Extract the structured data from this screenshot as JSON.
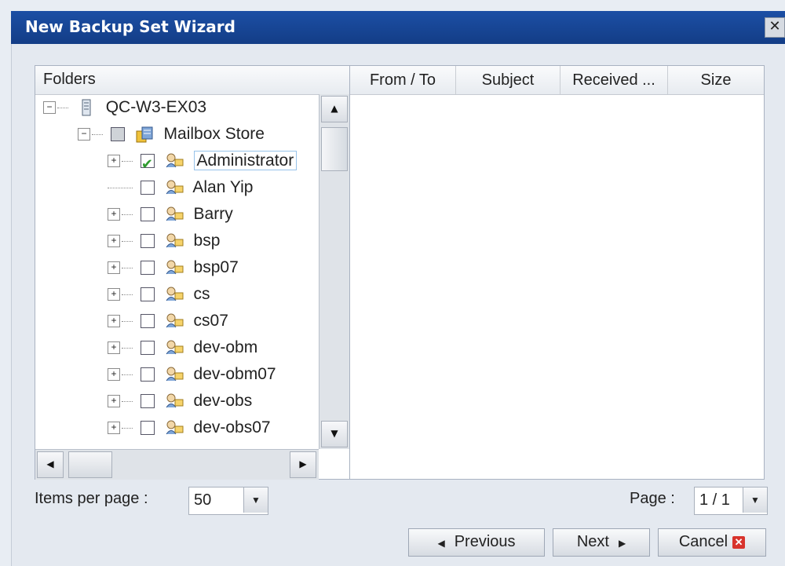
{
  "window": {
    "title": "New Backup Set Wizard",
    "close_glyph": "✕"
  },
  "folders": {
    "header": "Folders",
    "root": {
      "label": "QC-W3-EX03",
      "expander": "−"
    },
    "store": {
      "label": "Mailbox Store",
      "expander": "−"
    },
    "items": [
      {
        "label": "Administrator",
        "checked": true,
        "selected": true
      },
      {
        "label": "Alan Yip",
        "checked": false
      },
      {
        "label": "Barry",
        "checked": false
      },
      {
        "label": "bsp",
        "checked": false
      },
      {
        "label": "bsp07",
        "checked": false
      },
      {
        "label": "cs",
        "checked": false
      },
      {
        "label": "cs07",
        "checked": false
      },
      {
        "label": "dev-obm",
        "checked": false
      },
      {
        "label": "dev-obm07",
        "checked": false
      },
      {
        "label": "dev-obs",
        "checked": false
      },
      {
        "label": "dev-obs07",
        "checked": false
      }
    ]
  },
  "messages": {
    "columns": [
      "From / To",
      "Subject",
      "Received ...",
      "Size"
    ]
  },
  "pagination": {
    "items_label": "Items per page :",
    "items_value": "50",
    "page_label": "Page :",
    "page_value": "1 / 1"
  },
  "buttons": {
    "previous": "Previous",
    "next": "Next",
    "cancel": "Cancel"
  },
  "icons": {
    "up": "▲",
    "down": "▼",
    "left": "◀",
    "right": "▶"
  }
}
